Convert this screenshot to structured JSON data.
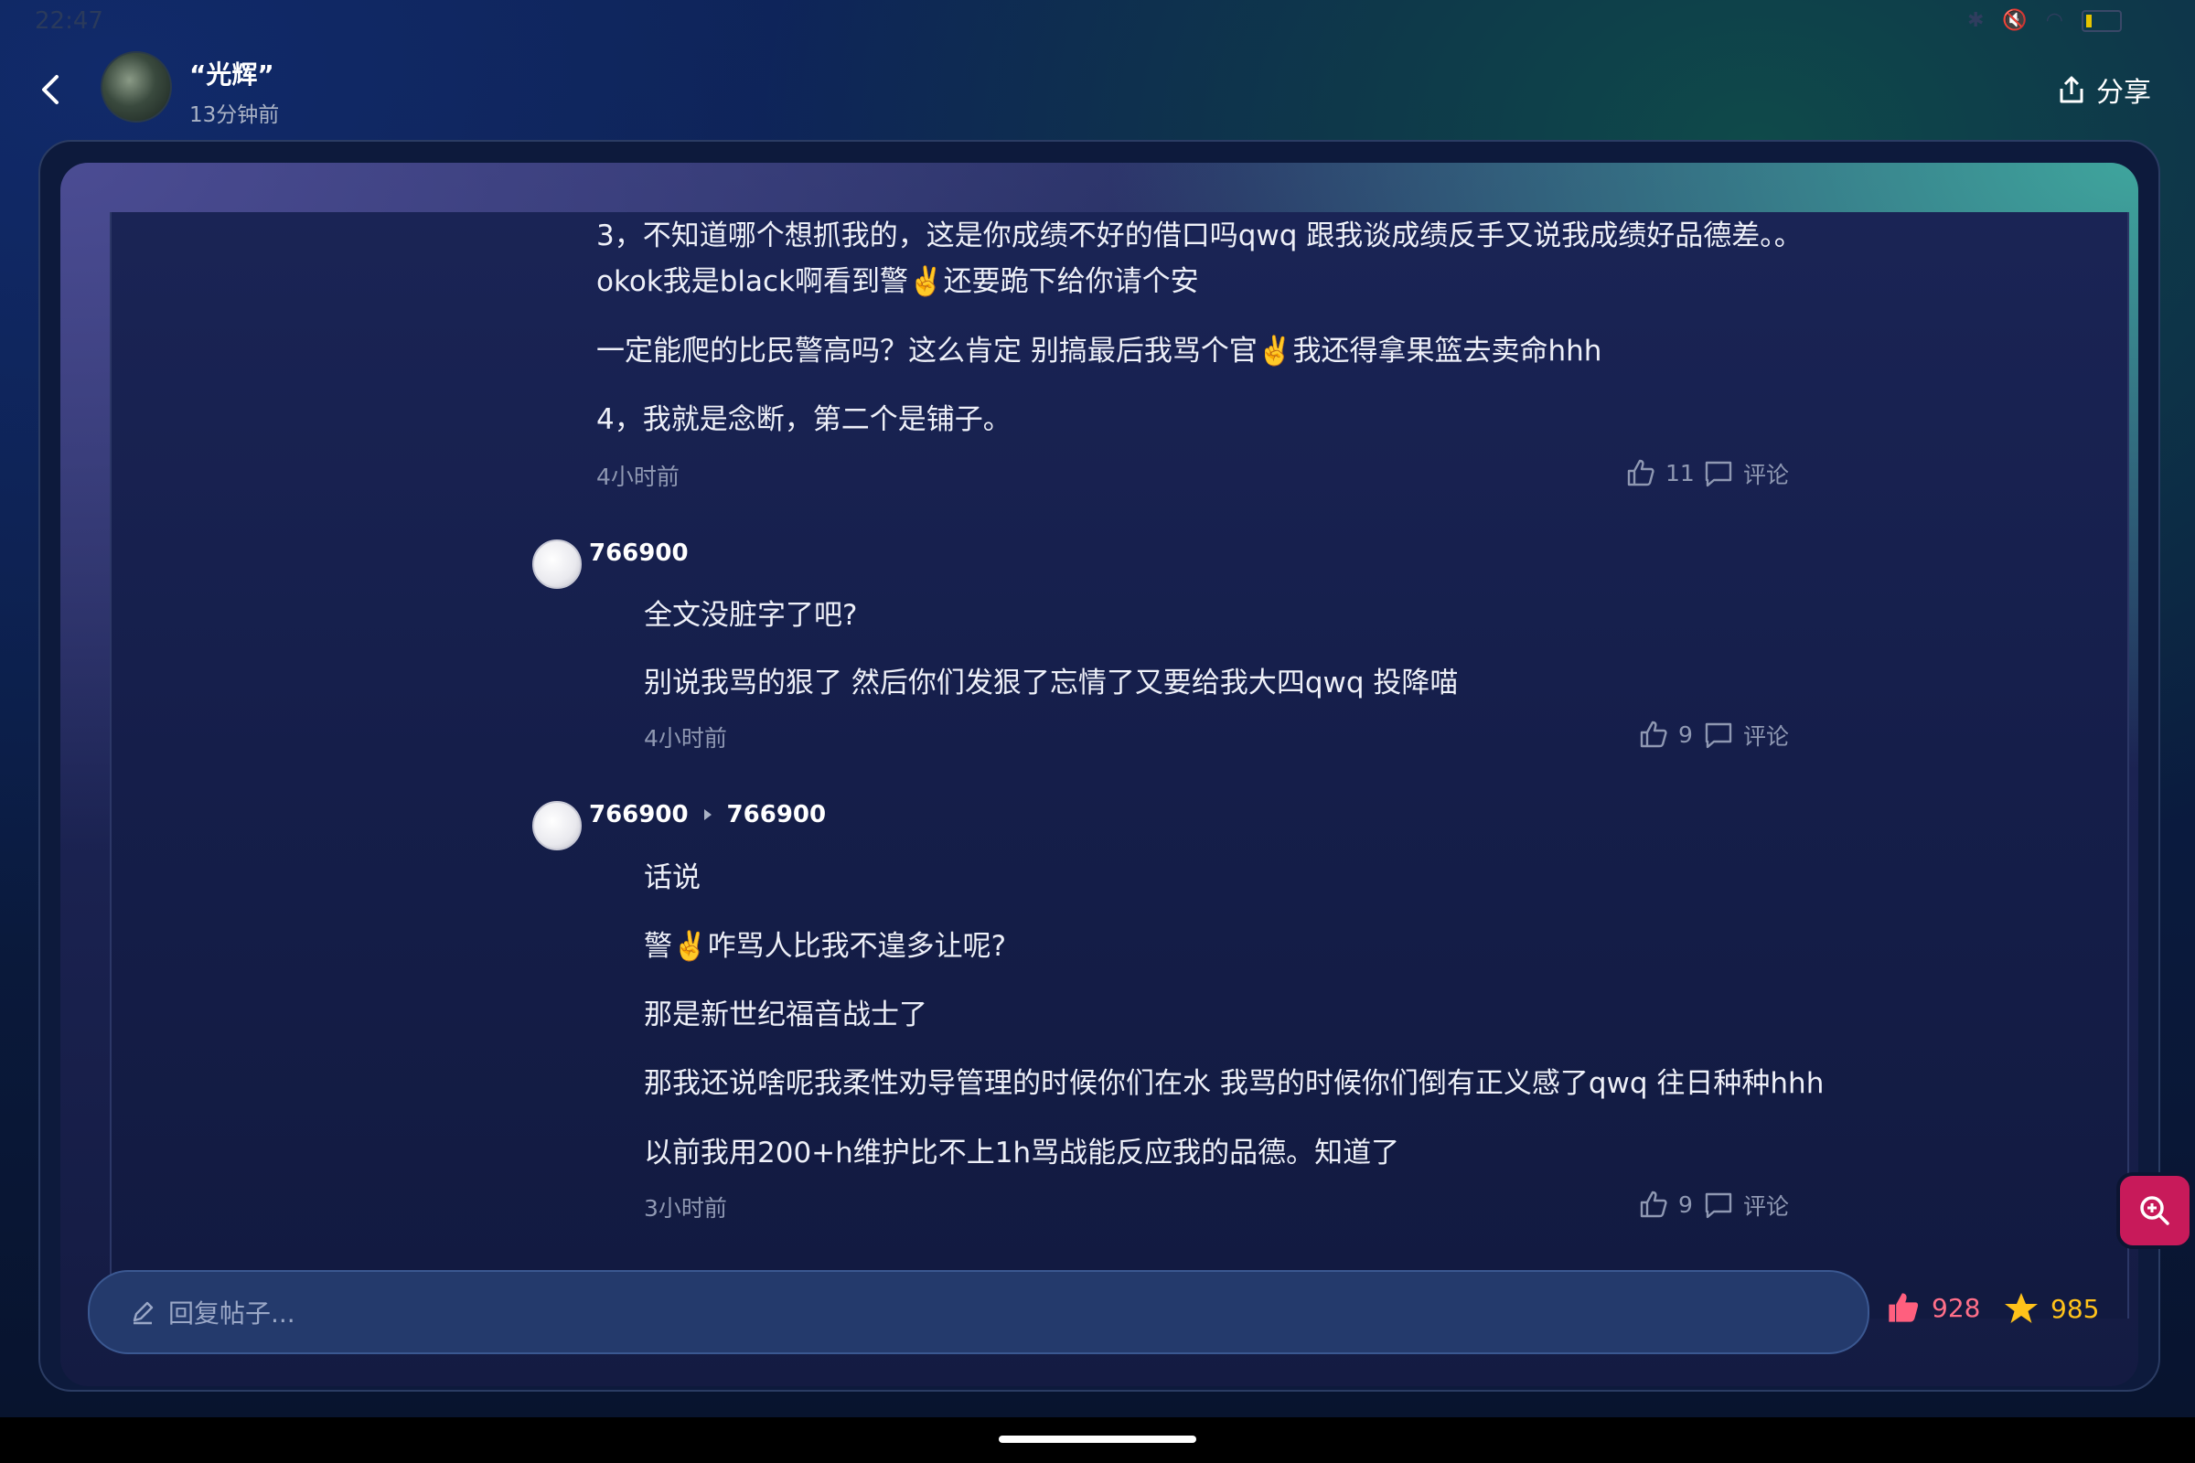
{
  "status_bar": {
    "time": "22:47",
    "icons": [
      "bluetooth-icon",
      "mute-icon",
      "wifi-icon",
      "battery-icon"
    ]
  },
  "header": {
    "poster_name": "“光辉”",
    "poster_time": "13分钟前",
    "share_label": "分享"
  },
  "posts": [
    {
      "paragraphs": [
        "3，不知道哪个想抓我的，这是你成绩不好的借口吗qwq 跟我谈成绩反手又说我成绩好品德差。。",
        "okok我是black啊看到警✌️还要跪下给你请个安",
        "一定能爬的比民警高吗？这么肯定 别搞最后我骂个官✌️我还得拿果篮去卖命hhh",
        "4，我就是念断，第二个是铺子。"
      ],
      "time": "4小时前",
      "likes": "11",
      "comment_label": "评论"
    },
    {
      "user": "766900",
      "paragraphs": [
        "全文没脏字了吧?",
        "别说我骂的狠了 然后你们发狠了忘情了又要给我大四qwq 投降喵"
      ],
      "time": "4小时前",
      "likes": "9",
      "comment_label": "评论"
    },
    {
      "user": "766900",
      "reply_to": "766900",
      "paragraphs": [
        "话说",
        "警✌️咋骂人比我不遑多让呢?",
        "那是新世纪福音战士了",
        "那我还说啥呢我柔性劝导管理的时候你们在水 我骂的时候你们倒有正义感了qwq 往日种种hhh",
        "以前我用200+h维护比不上1h骂战能反应我的品德。知道了"
      ],
      "time": "3小时前",
      "likes": "9",
      "comment_label": "评论"
    }
  ],
  "reply_bar": {
    "placeholder": "回复帖子...",
    "likes_total": "928",
    "stars_total": "985"
  },
  "colors": {
    "accent_like": "#ff6f89",
    "accent_star": "#ffc21a",
    "zoom_button": "#c81a5a"
  }
}
